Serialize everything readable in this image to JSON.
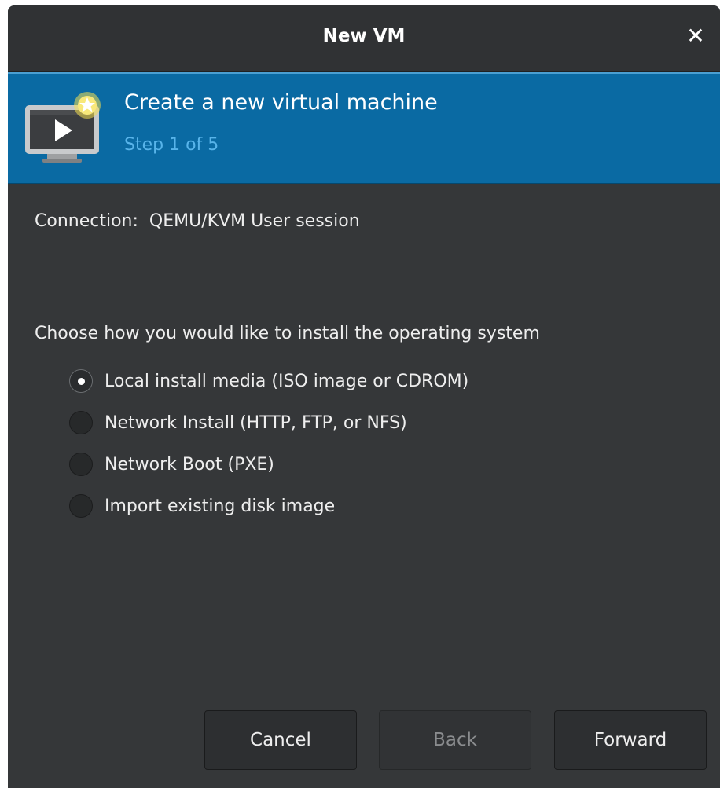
{
  "window": {
    "title": "New VM",
    "close_symbol": "✕"
  },
  "banner": {
    "title": "Create a new virtual machine",
    "step": "Step 1 of 5",
    "icon": "vm-monitor-new-icon",
    "color": "#0a6aa3"
  },
  "connection": {
    "label": "Connection:",
    "value": "QEMU/KVM User session"
  },
  "install": {
    "prompt": "Choose how you would like to install the operating system",
    "options": [
      {
        "label": "Local install media (ISO image or CDROM)",
        "selected": true
      },
      {
        "label": "Network Install (HTTP, FTP, or NFS)",
        "selected": false
      },
      {
        "label": "Network Boot (PXE)",
        "selected": false
      },
      {
        "label": "Import existing disk image",
        "selected": false
      }
    ]
  },
  "buttons": {
    "cancel": "Cancel",
    "back": "Back",
    "forward": "Forward",
    "back_enabled": false
  }
}
